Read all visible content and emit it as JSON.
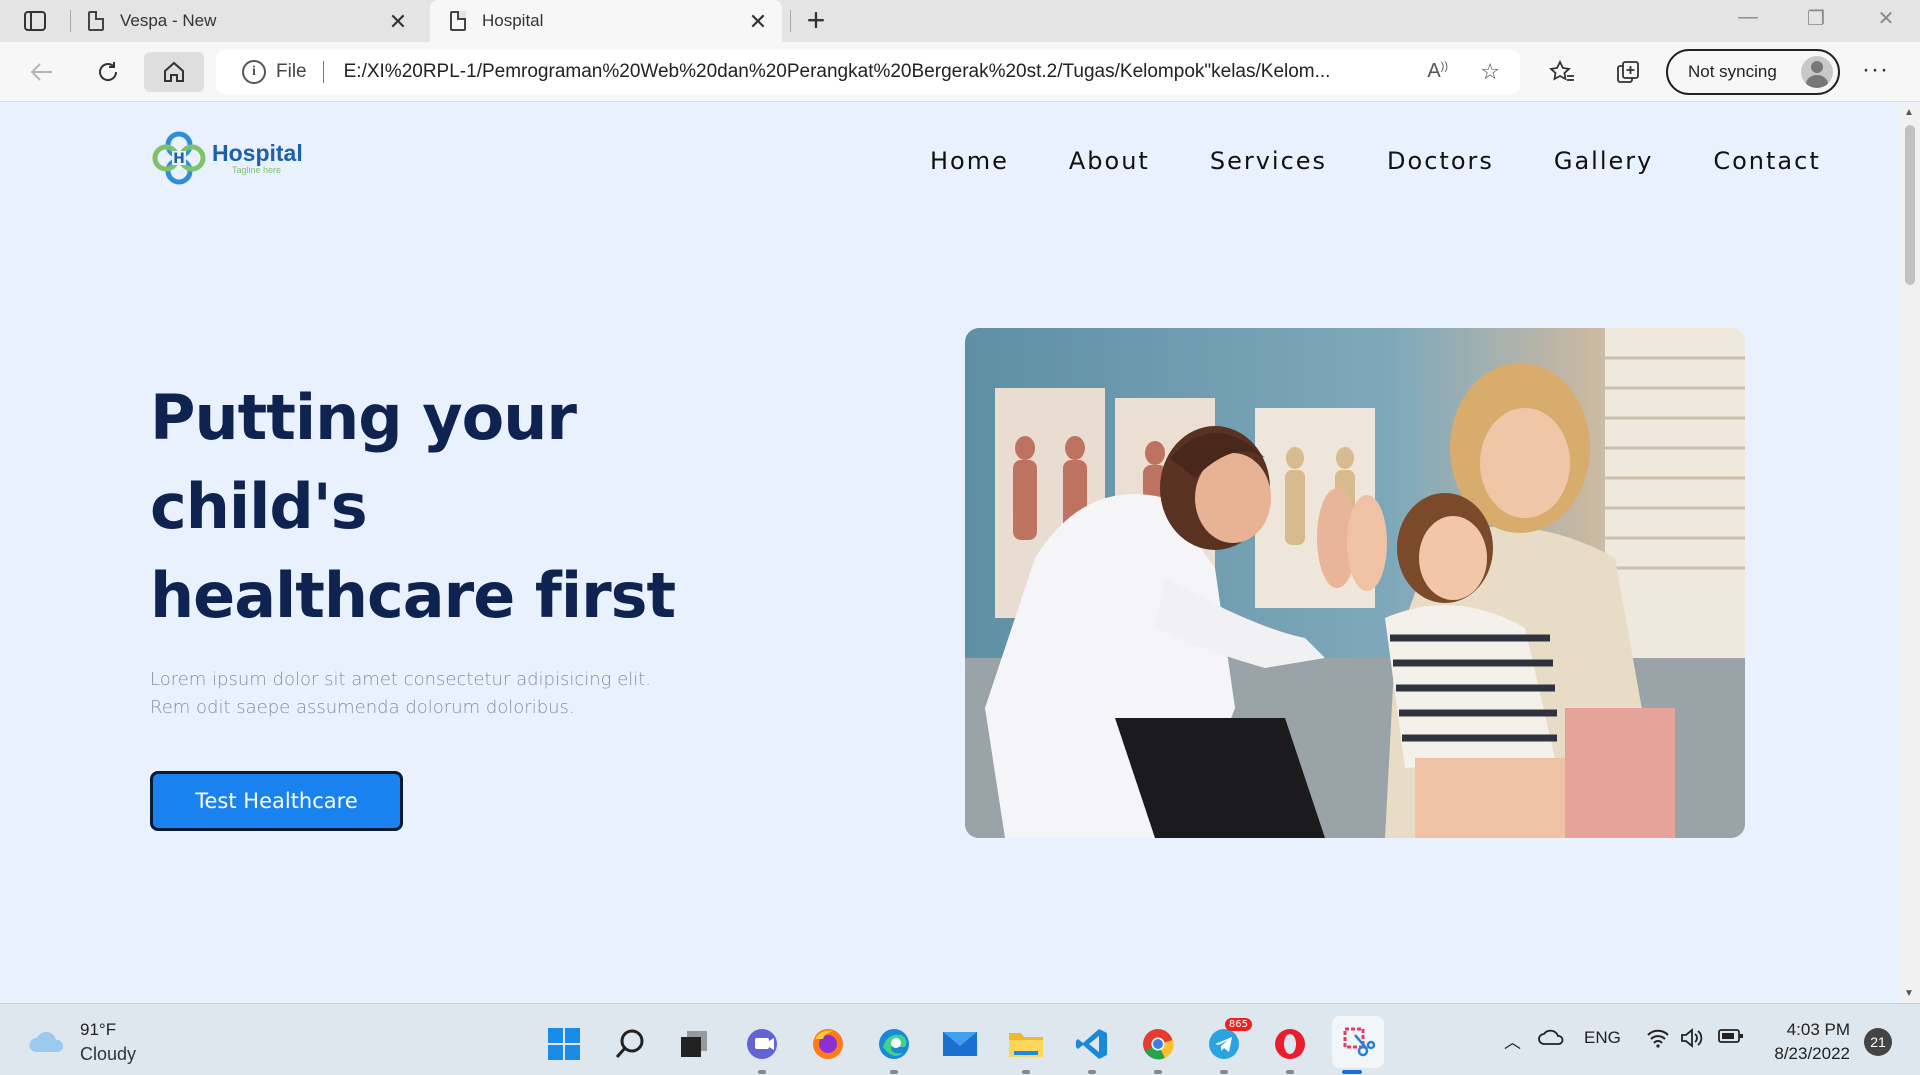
{
  "browser": {
    "tabs": [
      {
        "title": "Vespa - New",
        "active": false
      },
      {
        "title": "Hospital",
        "active": true
      }
    ],
    "address": {
      "scheme_label": "File",
      "url": "E:/XI%20RPL-1/Pemrograman%20Web%20dan%20Perangkat%20Bergerak%20st.2/Tugas/Kelompok\"kelas/Kelom..."
    },
    "sync_label": "Not syncing"
  },
  "site": {
    "logo": {
      "name": "Hospital",
      "tagline": "Tagline here"
    },
    "nav": [
      {
        "label": "Home"
      },
      {
        "label": "About"
      },
      {
        "label": "Services"
      },
      {
        "label": "Doctors"
      },
      {
        "label": "Gallery"
      },
      {
        "label": "Contact"
      }
    ],
    "hero": {
      "title_line1": "Putting your",
      "title_line2": "child's",
      "title_line3": "healthcare first",
      "description_line1": "Lorem ipsum dolor sit amet consectetur adipisicing elit.",
      "description_line2": "Rem odit saepe assumenda dolorum doloribus.",
      "button_label": "Test Healthcare"
    }
  },
  "taskbar": {
    "weather": {
      "temp": "91°F",
      "condition": "Cloudy"
    },
    "apps": [
      "windows-start",
      "search",
      "task-view",
      "teams-chat",
      "firefox",
      "edge",
      "mail",
      "file-explorer",
      "vscode",
      "chrome",
      "telegram",
      "opera",
      "snipping-tool"
    ],
    "telegram_badge": "865",
    "language": "ENG",
    "time": "4:03 PM",
    "date": "8/23/2022",
    "notifications": "21"
  },
  "colors": {
    "page_bg": "#e8f1fd",
    "title": "#0f2350",
    "button": "#1a82ee",
    "logo_blue": "#1f5fa8",
    "logo_green": "#7ec36b"
  }
}
